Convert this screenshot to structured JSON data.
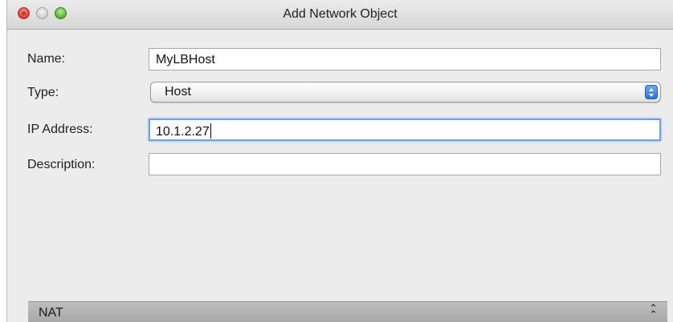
{
  "window": {
    "title": "Add Network Object"
  },
  "form": {
    "name_label": "Name:",
    "name_value": "MyLBHost",
    "type_label": "Type:",
    "type_value": "Host",
    "ip_label": "IP Address:",
    "ip_value": "10.1.2.27",
    "description_label": "Description:",
    "description_value": ""
  },
  "nat": {
    "label": "NAT",
    "collapse_icon": "double-chevron-up-icon"
  }
}
